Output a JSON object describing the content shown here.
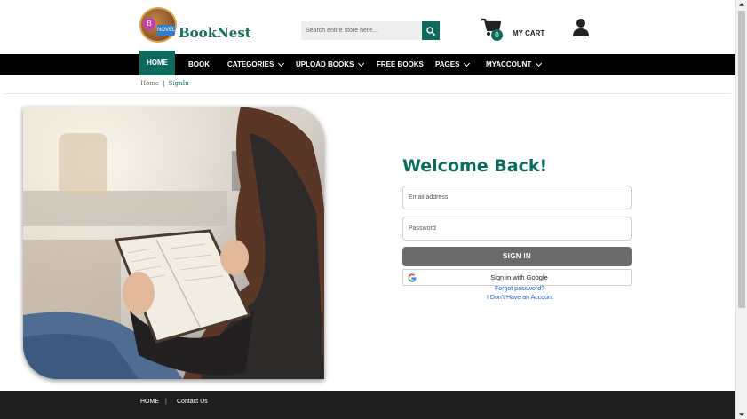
{
  "brand": {
    "name": "BookNest",
    "badge_letter": "B",
    "badge_sub": "NOVEL"
  },
  "search": {
    "placeholder": "Search entire store here...",
    "icon": "search-icon"
  },
  "cart": {
    "count": "0",
    "label": "MY CART",
    "icon": "cart-icon"
  },
  "account": {
    "icon": "user-icon"
  },
  "nav": {
    "items": [
      {
        "label": "HOME",
        "active": true
      },
      {
        "label": "BOOK"
      },
      {
        "label": "CATEGORIES",
        "dropdown": true
      },
      {
        "label": "UPLOAD BOOKS",
        "dropdown": true
      },
      {
        "label": "FREE BOOKS"
      },
      {
        "label": "PAGES",
        "dropdown": true
      },
      {
        "label": "MYACCOUNT",
        "dropdown": true
      }
    ]
  },
  "breadcrumb": {
    "home": "Home",
    "separator": "|",
    "current": "SignIn"
  },
  "login": {
    "heading": "Welcome Back!",
    "email_placeholder": "Email address",
    "password_placeholder": "Password",
    "signin_label": "SIGN IN",
    "google_label": "Sign in with Google",
    "forgot_label": "Forgot password?",
    "register_label": "I Don't Have an Account"
  },
  "footer": {
    "links": [
      "HOME",
      "Contact Us"
    ],
    "separator": "|"
  },
  "colors": {
    "brand_green": "#0d6b5e",
    "nav_bg": "#000000",
    "signin_bg": "#6b6b6b",
    "link_blue": "#1a5fd0",
    "footer_bg": "#1e1e1e"
  }
}
